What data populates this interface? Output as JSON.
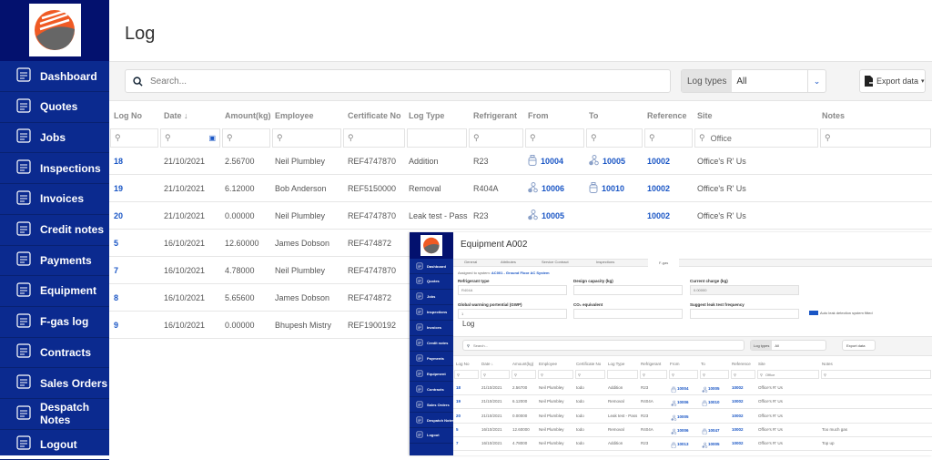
{
  "page_title": "Log",
  "colors": {
    "sidebar": "#0b2a8f",
    "sidebar_top": "#03116e",
    "link": "#1a56c5",
    "logo_orange": "#ef5a24"
  },
  "sidebar": {
    "items": [
      {
        "label": "Dashboard",
        "icon": "dashboard-icon"
      },
      {
        "label": "Quotes",
        "icon": "quotes-icon"
      },
      {
        "label": "Jobs",
        "icon": "wrench-icon"
      },
      {
        "label": "Inspections",
        "icon": "clipboard-check-icon"
      },
      {
        "label": "Invoices",
        "icon": "invoice-icon"
      },
      {
        "label": "Credit notes",
        "icon": "credit-note-icon"
      },
      {
        "label": "Payments",
        "icon": "payment-card-icon"
      },
      {
        "label": "Equipment",
        "icon": "equipment-icon"
      },
      {
        "label": "F-gas log",
        "icon": "gas-cylinder-icon"
      },
      {
        "label": "Contracts",
        "icon": "handshake-icon"
      },
      {
        "label": "Sales Orders",
        "icon": "cart-icon"
      },
      {
        "label": "Despatch Notes",
        "icon": "cart-icon"
      },
      {
        "label": "Logout",
        "icon": "gear-icon"
      }
    ]
  },
  "toolbar": {
    "search_placeholder": "Search...",
    "log_types_label": "Log types",
    "log_types_value": "All",
    "export_label": "Export data"
  },
  "table": {
    "columns": [
      "Log No",
      "Date ↓",
      "Amount(kg)",
      "Employee",
      "Certificate No",
      "Log Type",
      "Refrigerant",
      "From",
      "To",
      "Reference",
      "Site",
      "Notes"
    ],
    "site_filter": "Office",
    "rows": [
      [
        "18",
        "21/10/2021",
        "2.56700",
        "Neil Plumbley",
        "REF4747870",
        "Addition",
        "R23",
        "10004",
        "10005",
        "10002",
        "Office's R' Us",
        ""
      ],
      [
        "19",
        "21/10/2021",
        "6.12000",
        "Bob Anderson",
        "REF5150000",
        "Removal",
        "R404A",
        "10006",
        "10010",
        "10002",
        "Office's R' Us",
        ""
      ],
      [
        "20",
        "21/10/2021",
        "0.00000",
        "Neil Plumbley",
        "REF4747870",
        "Leak test - Pass",
        "R23",
        "10005",
        "",
        "10002",
        "Office's R' Us",
        ""
      ],
      [
        "5",
        "16/10/2021",
        "12.60000",
        "James Dobson",
        "REF474872"
      ],
      [
        "7",
        "16/10/2021",
        "4.78000",
        "Neil Plumbley",
        "REF4747870"
      ],
      [
        "8",
        "16/10/2021",
        "5.65600",
        "James Dobson",
        "REF474872"
      ],
      [
        "9",
        "16/10/2021",
        "0.00000",
        "Bhupesh Mistry",
        "REF1900192"
      ]
    ],
    "from_icons": [
      "cylinder",
      "equipment",
      "equipment"
    ],
    "to_icons": [
      "equipment",
      "cylinder",
      ""
    ]
  },
  "inset": {
    "title": "Equipment A002",
    "tabs": [
      "General",
      "Attributes",
      "Service Contract",
      "Inspections",
      "F-gas"
    ],
    "assigned_prefix": "Assigned to system:",
    "assigned_link": "AC001 - Ground Floor AC System",
    "fields": {
      "refrigerant_type_label": "Refrigerant type",
      "refrigerant_type_value": "R404A",
      "design_capacity_label": "Design capacity (kg)",
      "current_charge_label": "Current charge (kg)",
      "current_charge_value": "0.00000",
      "gwp_label": "Global warming portential (GWP)",
      "gwp_value": "1",
      "co2_label": "CO₂ equivalent",
      "leak_freq_label": "Suggest leak test frequency",
      "auto_leak_label": "Auto leak detection system fitted"
    },
    "sidebar": [
      "Dashboard",
      "Quotes",
      "Jobs",
      "Inspections",
      "Invoices",
      "Credit notes",
      "Payments",
      "Equipment",
      "Contracts",
      "Sales Orders",
      "Despatch Notes",
      "Logout"
    ],
    "log_title": "Log",
    "toolbar": {
      "search_placeholder": "Search...",
      "log_types_label": "Log types",
      "log_types_value": "All",
      "export_label": "Export data"
    },
    "site_filter": "Office",
    "rows": [
      [
        "18",
        "21/10/2021",
        "2.56700",
        "Neil Plumbley",
        "todo",
        "Addition",
        "R23",
        "10004",
        "10005",
        "10002",
        "Office's R' Us",
        ""
      ],
      [
        "19",
        "21/10/2021",
        "6.12000",
        "Neil Plumbley",
        "todo",
        "Removal",
        "R404A",
        "10006",
        "10010",
        "10002",
        "Office's R' Us",
        ""
      ],
      [
        "20",
        "21/10/2021",
        "0.00000",
        "Neil Plumbley",
        "todo",
        "Leak test - Pass",
        "R23",
        "10005",
        "",
        "10002",
        "Office's R' Us",
        ""
      ],
      [
        "5",
        "16/10/2021",
        "12.60000",
        "Neil Plumbley",
        "todo",
        "Removal",
        "R404A",
        "10006",
        "10047",
        "10002",
        "Office's R' Us",
        "Too much gas"
      ],
      [
        "7",
        "16/10/2021",
        "4.78000",
        "Neil Plumbley",
        "todo",
        "Addition",
        "R23",
        "10013",
        "10005",
        "10002",
        "Office's R' Us",
        "Top up"
      ]
    ],
    "from_icons": [
      "cylinder",
      "equipment",
      "equipment",
      "equipment",
      "cylinder"
    ],
    "to_icons": [
      "equipment",
      "cylinder",
      "",
      "cylinder",
      "equipment"
    ]
  }
}
